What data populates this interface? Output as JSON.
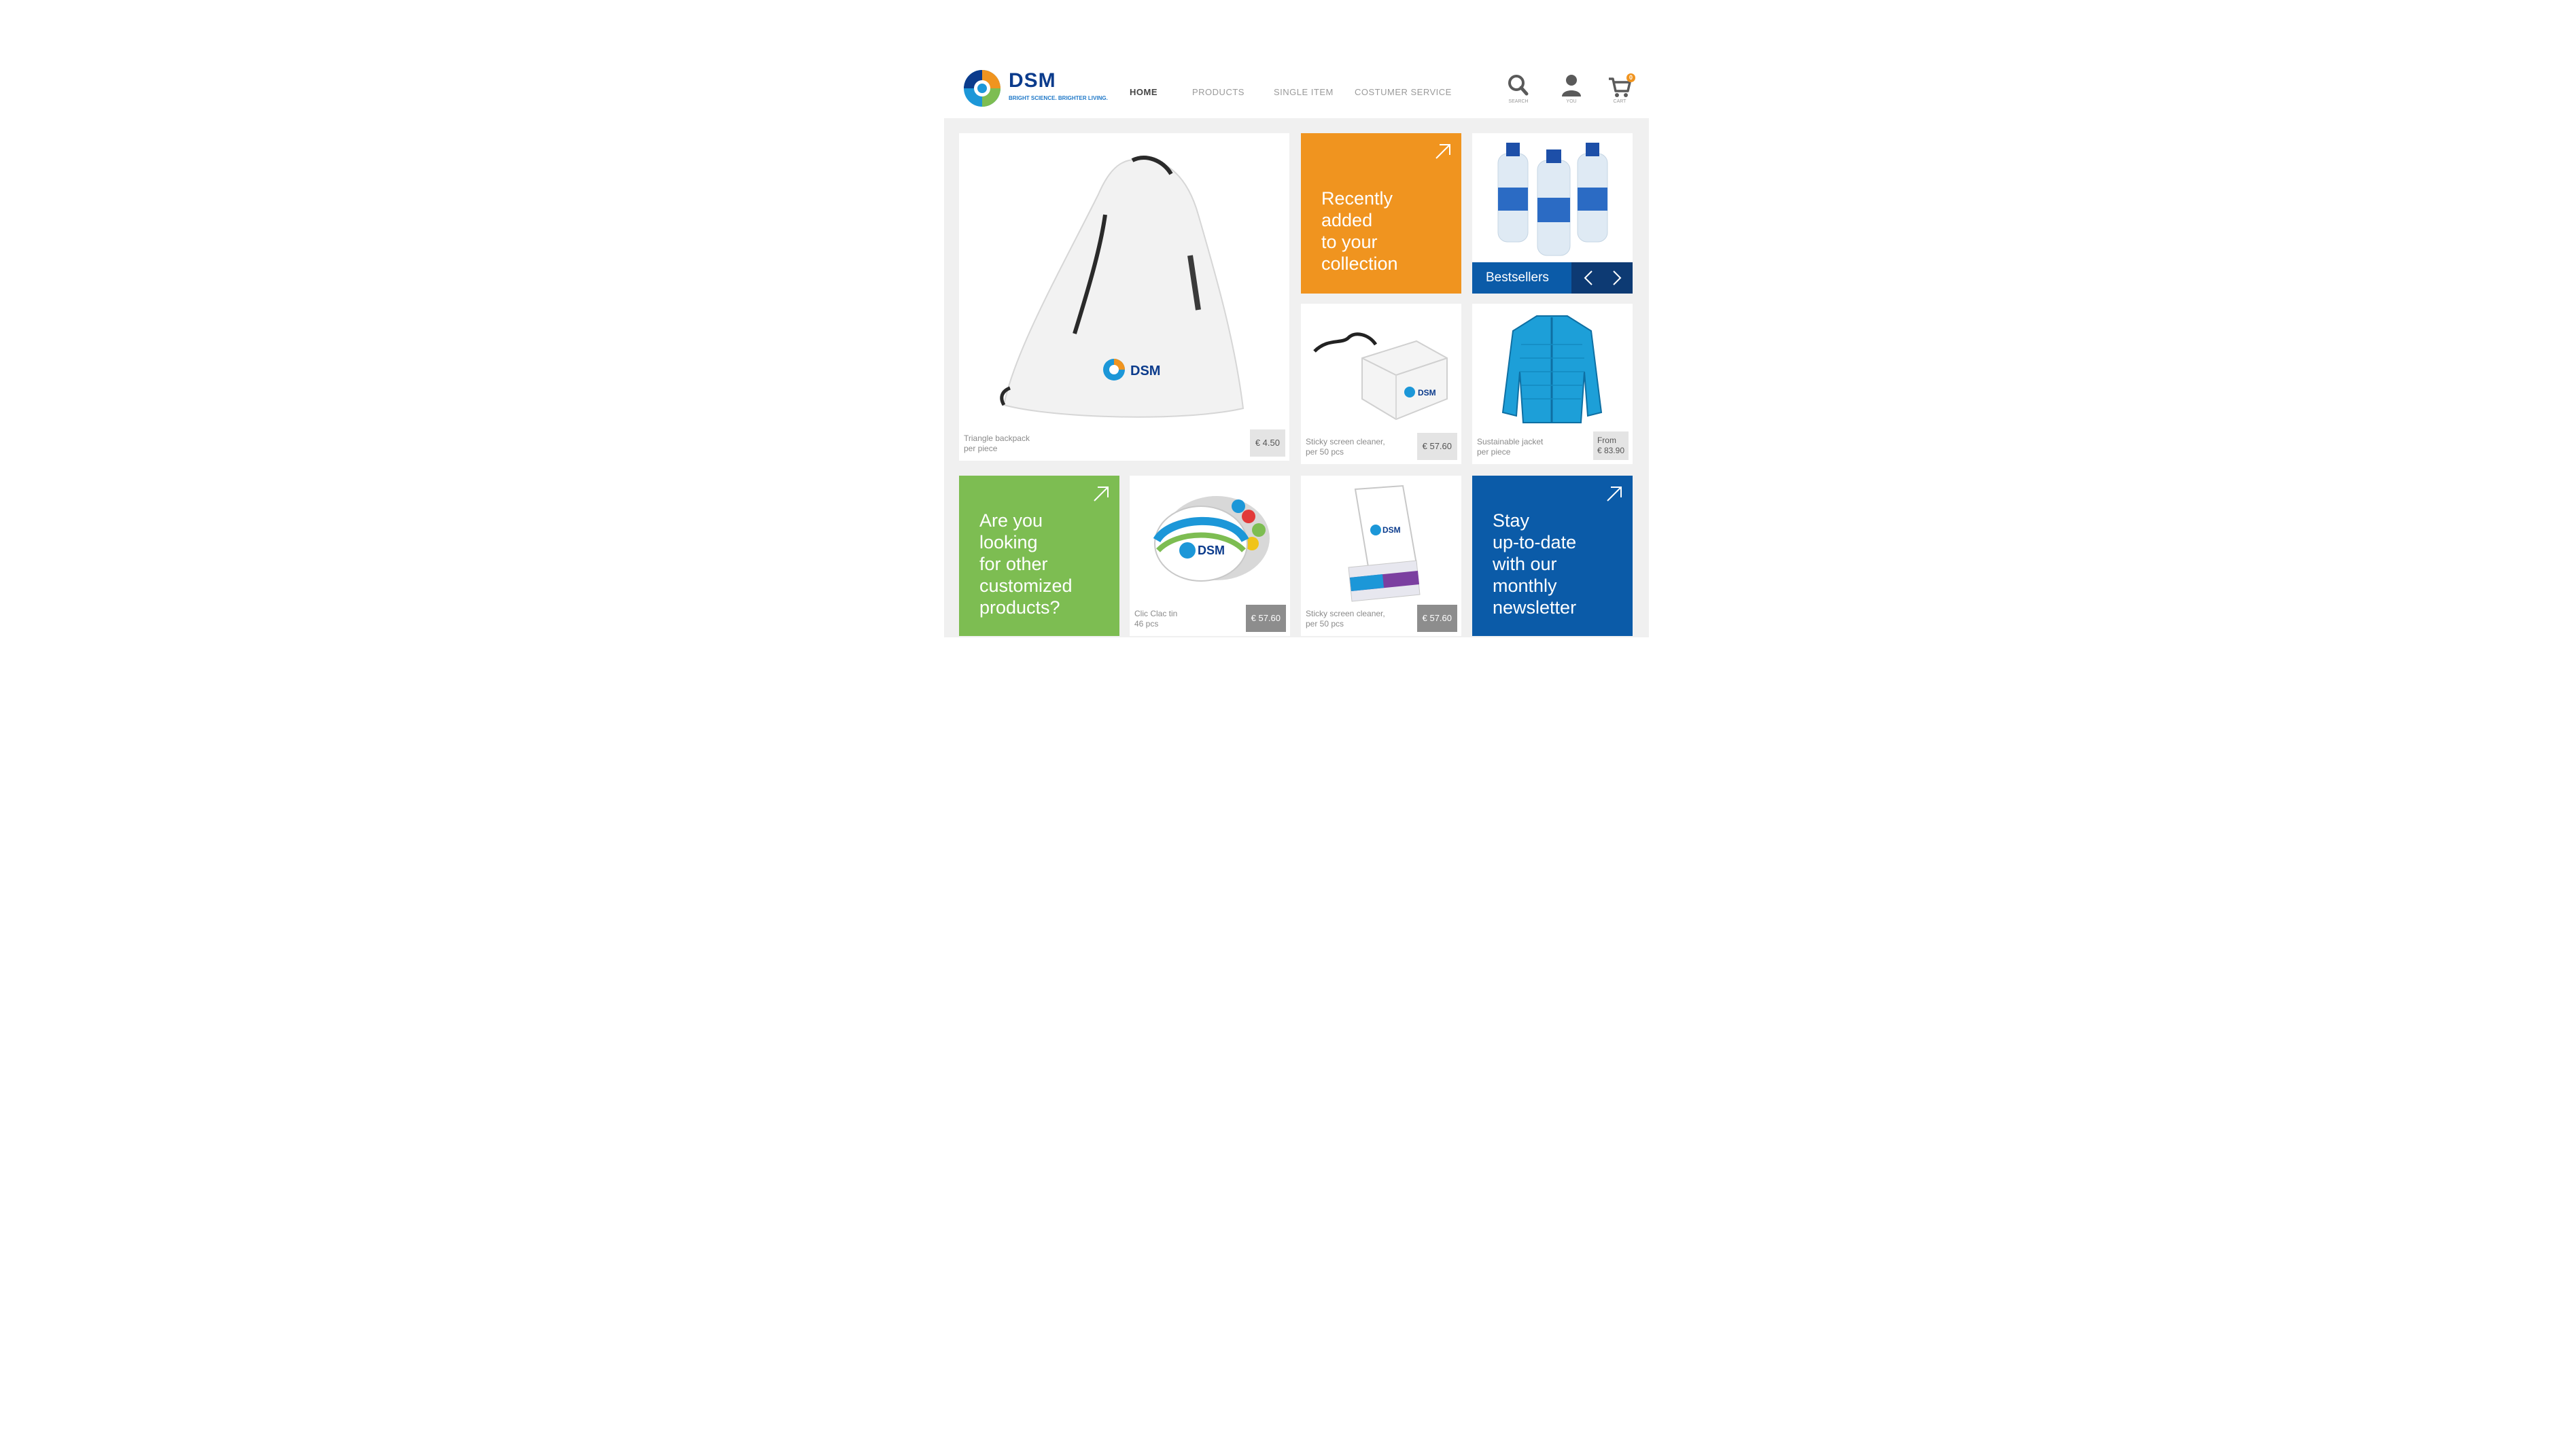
{
  "brand": {
    "name": "DSM",
    "tagline": "BRIGHT SCIENCE. BRIGHTER LIVING."
  },
  "nav": {
    "home": "HOME",
    "products": "PRODUCTS",
    "single_item": "SINGLE ITEM",
    "customer_service": "COSTUMER SERVICE"
  },
  "header_icons": {
    "search": "SEARCH",
    "you": "YOU",
    "cart": "CART",
    "cart_count": "0"
  },
  "tiles": {
    "backpack": {
      "name": "Triangle backpack",
      "unit": "per piece",
      "price": "€ 4.50"
    },
    "recently_added": {
      "line1": "Recently",
      "line2": "added",
      "line3": "to your",
      "line4": "collection"
    },
    "bestsellers": {
      "label": "Bestsellers"
    },
    "screen_cleaner_1": {
      "name": "Sticky screen cleaner,",
      "unit": "per 50 pcs",
      "price": "€ 57.60"
    },
    "jacket": {
      "name": "Sustainable jacket",
      "unit": "per piece",
      "price_line1": "From",
      "price_line2": "€ 83.90"
    },
    "customized": {
      "line1": "Are you",
      "line2": "looking",
      "line3": "for other",
      "line4": "customized",
      "line5": "products?"
    },
    "clic_clac": {
      "name": "Clic Clac tin",
      "unit": "46 pcs",
      "price": "€ 57.60"
    },
    "screen_cleaner_2": {
      "name": "Sticky screen cleaner,",
      "unit": "per 50 pcs",
      "price": "€ 57.60"
    },
    "newsletter": {
      "line1": "Stay",
      "line2": "up-to-date",
      "line3": "with our",
      "line4": "monthly",
      "line5": "newsletter"
    }
  },
  "colors": {
    "orange": "#f0941f",
    "green": "#7dbd52",
    "blue": "#0b5ba8",
    "dark_blue": "#0d3a73"
  }
}
